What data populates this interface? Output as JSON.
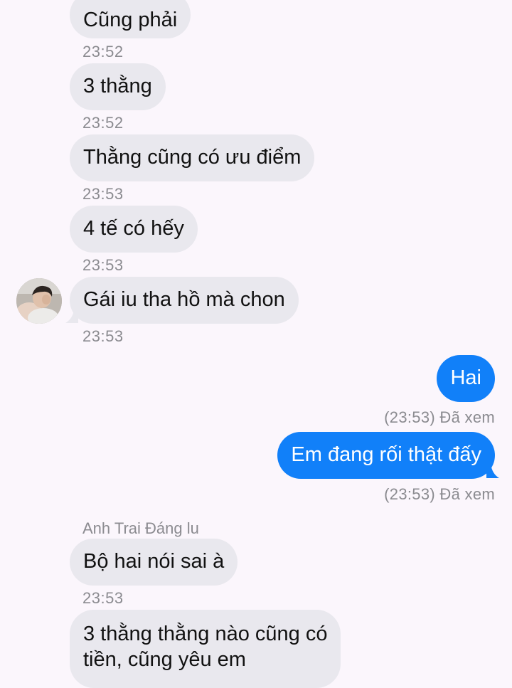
{
  "conversation": {
    "messages": [
      {
        "text": "Cũng phải",
        "time": "23:52"
      },
      {
        "text": "3 thằng",
        "time": "23:52"
      },
      {
        "text": "Thằng cũng có ưu điểm",
        "time": "23:53"
      },
      {
        "text": "4 tế có hếy",
        "time": "23:53"
      },
      {
        "text": "Gái iu tha hồ mà chon",
        "time": "23:53"
      },
      {
        "text": "Hai",
        "status": "(23:53) Đã xem"
      },
      {
        "text": "Em đang rối thật đấy",
        "status": "(23:53) Đã xem"
      },
      {
        "sender": "Anh Trai Đáng lu",
        "text": "Bộ hai nói sai à",
        "time": "23:53"
      },
      {
        "text_line1": "3 thằng thằng nào cũng có",
        "text_line2": "tiền, cũng yêu em"
      }
    ]
  },
  "colors": {
    "background": "#fbf6fc",
    "incoming_bubble": "#e9e8ee",
    "outgoing_bubble": "#1180f9",
    "meta_text": "#8b8b90"
  },
  "icons": {
    "avatar": "contact-avatar-photo"
  }
}
